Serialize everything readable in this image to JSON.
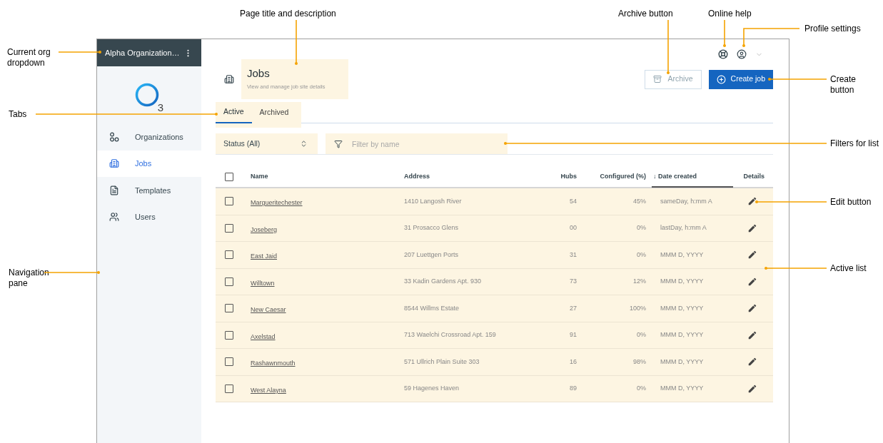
{
  "callouts": [
    {
      "text": "Current org dropdown"
    },
    {
      "text": "Page title and description"
    },
    {
      "text": "Archive button"
    },
    {
      "text": "Online help"
    },
    {
      "text": "Profile settings"
    },
    {
      "text": "Create button"
    },
    {
      "text": "Tabs"
    },
    {
      "text": "Filters for list"
    },
    {
      "text": "Edit button"
    },
    {
      "text": "Active list"
    },
    {
      "text": "Navigation pane"
    }
  ],
  "sidebar": {
    "org_name": "Alpha Organization…",
    "logo_digit": "3",
    "items": [
      {
        "label": "Organizations",
        "selected": false
      },
      {
        "label": "Jobs",
        "selected": true
      },
      {
        "label": "Templates",
        "selected": false
      },
      {
        "label": "Users",
        "selected": false
      }
    ]
  },
  "page": {
    "title": "Jobs",
    "description": "View and manage job site details",
    "archive_button": "Archive",
    "create_button": "Create job"
  },
  "tabs": [
    {
      "label": "Active",
      "selected": true
    },
    {
      "label": "Archived",
      "selected": false
    }
  ],
  "filters": {
    "status": "Status (All)",
    "search_placeholder": "Filter by name"
  },
  "table": {
    "all_checked": false,
    "columns": [
      {
        "label": "Name",
        "sorted": false
      },
      {
        "label": "Address",
        "sorted": false
      },
      {
        "label": "Hubs",
        "sorted": false
      },
      {
        "label": "Configured (%)",
        "sorted": false
      },
      {
        "label": "↓ Date created",
        "sorted": true
      },
      {
        "label": "Details",
        "sorted": false
      }
    ],
    "rows": [
      {
        "checked": false,
        "name": "Margueritechester",
        "address": "1410 Langosh River",
        "hubs": "54",
        "configured": "45%",
        "date_created": "sameDay, h:mm A"
      },
      {
        "checked": false,
        "name": "Joseberg",
        "address": "31 Prosacco Glens",
        "hubs": "00",
        "configured": "0%",
        "date_created": "lastDay, h:mm A"
      },
      {
        "checked": false,
        "name": "East Jaid",
        "address": "207 Luettgen Ports",
        "hubs": "31",
        "configured": "0%",
        "date_created": "MMM D, YYYY"
      },
      {
        "checked": false,
        "name": "Willtown",
        "address": "33 Kadin Gardens Apt. 930",
        "hubs": "73",
        "configured": "12%",
        "date_created": "MMM D, YYYY"
      },
      {
        "checked": false,
        "name": "New Caesar",
        "address": "8544 Willms Estate",
        "hubs": "27",
        "configured": "100%",
        "date_created": "MMM D, YYYY"
      },
      {
        "checked": false,
        "name": "Axelstad",
        "address": "713 Waelchi Crossroad Apt. 159",
        "hubs": "91",
        "configured": "0%",
        "date_created": "MMM D, YYYY"
      },
      {
        "checked": false,
        "name": "Rashawnmouth",
        "address": "571 Ullrich Plain Suite 303",
        "hubs": "16",
        "configured": "98%",
        "date_created": "MMM D, YYYY"
      },
      {
        "checked": false,
        "name": "West Alayna",
        "address": "59 Hagenes Haven",
        "hubs": "89",
        "configured": "0%",
        "date_created": "MMM D, YYYY"
      }
    ]
  }
}
